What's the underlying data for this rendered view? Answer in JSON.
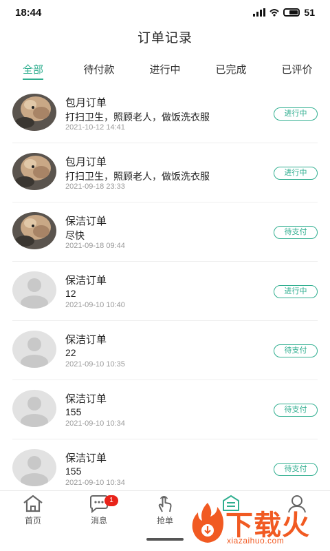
{
  "status_bar": {
    "time": "18:44",
    "battery": "51"
  },
  "header": {
    "title": "订单记录"
  },
  "tabs": [
    {
      "label": "全部",
      "active": true
    },
    {
      "label": "待付款",
      "active": false
    },
    {
      "label": "进行中",
      "active": false
    },
    {
      "label": "已完成",
      "active": false
    },
    {
      "label": "已评价",
      "active": false
    }
  ],
  "orders": [
    {
      "title": "包月订单",
      "desc": "打扫卫生，照顾老人，做饭洗衣服",
      "time": "2021-10-12 14:41",
      "status": "进行中",
      "avatar": "dog-photo"
    },
    {
      "title": "包月订单",
      "desc": "打扫卫生，照顾老人，做饭洗衣服",
      "time": "2021-09-18 23:33",
      "status": "进行中",
      "avatar": "dog-photo"
    },
    {
      "title": "保洁订单",
      "desc": "尽快",
      "time": "2021-09-18 09:44",
      "status": "待支付",
      "avatar": "dog-photo"
    },
    {
      "title": "保洁订单",
      "desc": "12",
      "time": "2021-09-10 10:40",
      "status": "进行中",
      "avatar": "default-user"
    },
    {
      "title": "保洁订单",
      "desc": "22",
      "time": "2021-09-10 10:35",
      "status": "待支付",
      "avatar": "default-user"
    },
    {
      "title": "保洁订单",
      "desc": "155",
      "time": "2021-09-10 10:34",
      "status": "待支付",
      "avatar": "default-user"
    },
    {
      "title": "保洁订单",
      "desc": "155",
      "time": "2021-09-10 10:34",
      "status": "待支付",
      "avatar": "default-user"
    }
  ],
  "bottom_nav": {
    "items": [
      {
        "label": "首页",
        "icon": "home-icon"
      },
      {
        "label": "消息",
        "icon": "message-icon",
        "badge": "1"
      },
      {
        "label": "抢单",
        "icon": "tap-hand-icon"
      },
      {
        "label": "",
        "icon": "orders-icon",
        "active": true
      },
      {
        "label": "",
        "icon": "profile-icon"
      }
    ]
  },
  "watermark": {
    "text": "下载火",
    "subtext": "xiazaihuo.com"
  },
  "colors": {
    "accent": "#2fae8f",
    "badge": "#e8231a",
    "watermark": "#f15a22",
    "muted": "#9a9a9a"
  }
}
